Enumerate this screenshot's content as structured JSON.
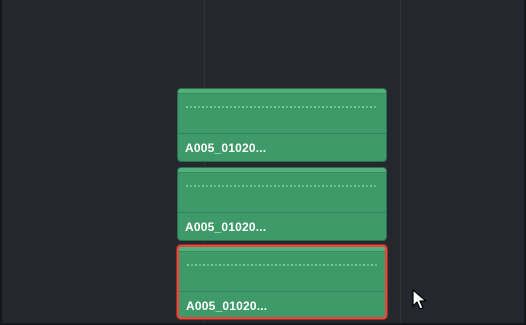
{
  "timeline": {
    "clips": [
      {
        "name": "A005_01020...",
        "selected": false
      },
      {
        "name": "A005_01020...",
        "selected": false
      },
      {
        "name": "A005_01020...",
        "selected": true
      }
    ]
  },
  "colors": {
    "background": "#24282e",
    "clip_fill": "#3f9a6a",
    "selection_outline": "#e24a3f"
  },
  "icons": {
    "cursor": "mouse-pointer-icon"
  }
}
